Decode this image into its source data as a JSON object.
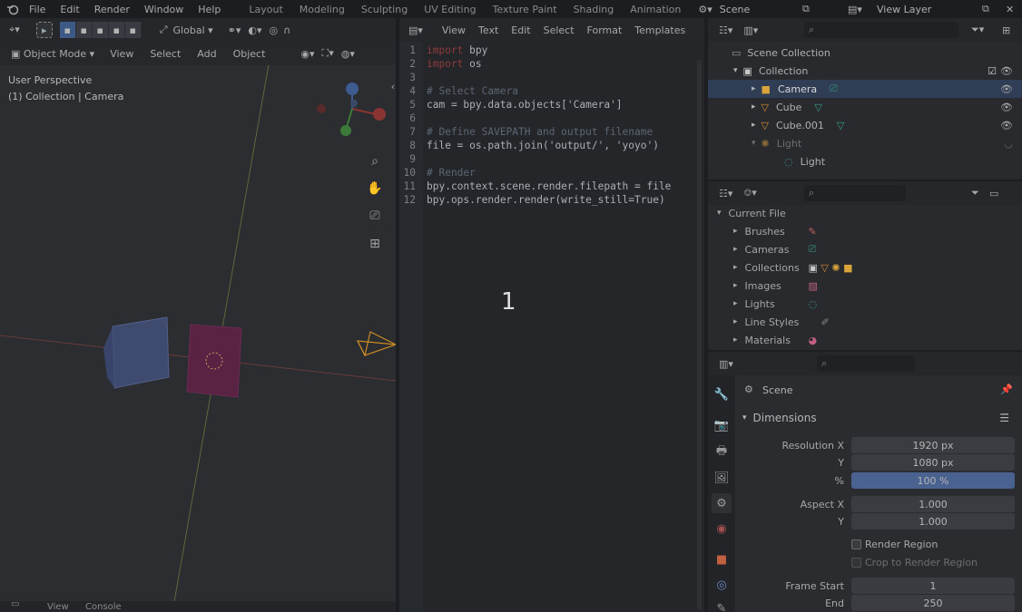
{
  "topbar": {
    "menus": [
      "File",
      "Edit",
      "Render",
      "Window",
      "Help"
    ],
    "workspaces": [
      "Layout",
      "Modeling",
      "Sculpting",
      "UV Editing",
      "Texture Paint",
      "Shading",
      "Animation"
    ],
    "scene_name": "Scene",
    "view_layer": "View Layer"
  },
  "viewport": {
    "orientation": "Global",
    "mode": "Object Mode",
    "menus": [
      "View",
      "Select",
      "Add",
      "Object"
    ],
    "overlay_line1": "User Perspective",
    "overlay_line2": "(1) Collection | Camera",
    "footer_labels": [
      "View",
      "Console"
    ]
  },
  "text_editor": {
    "menus": [
      "View",
      "Text",
      "Edit",
      "Select",
      "Format",
      "Templates"
    ],
    "lines": [
      {
        "n": "1",
        "text": "import bpy",
        "kind": "import"
      },
      {
        "n": "2",
        "text": "import os",
        "kind": "import"
      },
      {
        "n": "3",
        "text": "",
        "kind": "blank"
      },
      {
        "n": "4",
        "text": "# Select Camera",
        "kind": "comment"
      },
      {
        "n": "5",
        "text": "cam = bpy.data.objects['Camera']",
        "kind": "code"
      },
      {
        "n": "6",
        "text": "",
        "kind": "blank"
      },
      {
        "n": "7",
        "text": "# Define SAVEPATH and output filename",
        "kind": "comment"
      },
      {
        "n": "8",
        "text": "file = os.path.join('output/', 'yoyo')",
        "kind": "code"
      },
      {
        "n": "9",
        "text": "",
        "kind": "blank"
      },
      {
        "n": "10",
        "text": "# Render",
        "kind": "comment"
      },
      {
        "n": "11",
        "text": "bpy.context.scene.render.filepath = file",
        "kind": "code"
      },
      {
        "n": "12",
        "text": "bpy.ops.render.render(write_still=True)",
        "kind": "code"
      }
    ],
    "overlay_number": "1"
  },
  "outliner": {
    "title": "Scene Collection",
    "items": [
      {
        "label": "Collection",
        "indent": 1
      },
      {
        "label": "Camera",
        "indent": 2,
        "selected": true
      },
      {
        "label": "Cube",
        "indent": 2
      },
      {
        "label": "Cube.001",
        "indent": 2
      },
      {
        "label": "Light",
        "indent": 2,
        "dim": true
      },
      {
        "label": "Light",
        "indent": 3
      }
    ]
  },
  "file_browser": {
    "title": "Current File",
    "items": [
      "Brushes",
      "Cameras",
      "Collections",
      "Images",
      "Lights",
      "Line Styles",
      "Materials"
    ]
  },
  "properties": {
    "context": "Scene",
    "panel": "Dimensions",
    "resolution_x_label": "Resolution X",
    "resolution_x": "1920 px",
    "resolution_y_label": "Y",
    "resolution_y": "1080 px",
    "percent_label": "%",
    "percent": "100 %",
    "aspect_x_label": "Aspect X",
    "aspect_x": "1.000",
    "aspect_y_label": "Y",
    "aspect_y": "1.000",
    "render_region": "Render Region",
    "crop_region": "Crop to Render Region",
    "frame_start_label": "Frame Start",
    "frame_start": "1",
    "end_label": "End",
    "end": "250"
  }
}
